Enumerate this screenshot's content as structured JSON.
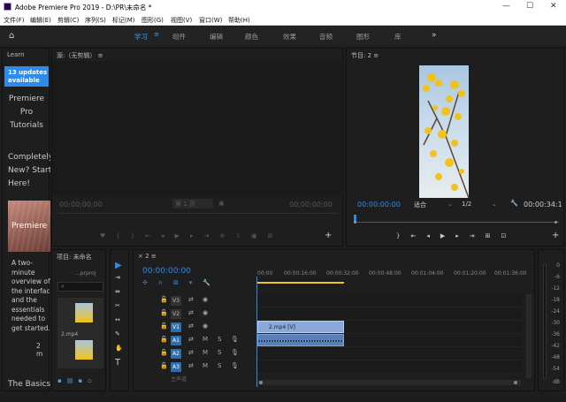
{
  "window": {
    "title": "Adobe Premiere Pro 2019 - D:\\PR\\未命名 *",
    "minimize": "—",
    "maximize": "☐",
    "close": "✕"
  },
  "menu": [
    "文件(F)",
    "编辑(E)",
    "剪辑(C)",
    "序列(S)",
    "标记(M)",
    "图形(G)",
    "视图(V)",
    "窗口(W)",
    "帮助(H)"
  ],
  "workspaces": {
    "items": [
      "学习",
      "组件",
      "编辑",
      "颜色",
      "效果",
      "音频",
      "图形",
      "库"
    ],
    "active": "学习",
    "more": "»"
  },
  "learn": {
    "tab": "Learn",
    "updates": "13 updates available",
    "tutorial": [
      "Premiere",
      "Pro",
      "Tutorials"
    ],
    "prompt": [
      "Completely",
      "New? Start",
      "Here!"
    ],
    "card_title": "Premiere",
    "desc": [
      "A two-",
      "minute",
      "overview of",
      "the interface",
      "and the",
      "essentials",
      "needed to",
      "get started."
    ],
    "duration": "2 m",
    "basics": "The Basics"
  },
  "source": {
    "title": "源:（无剪辑）",
    "tc_left": "00;00;00;00",
    "page": "第 1 页",
    "tc_right": "00;00;00;00"
  },
  "program": {
    "title": "节目: 2",
    "tc_left": "00:00:00:00",
    "fit": "适合",
    "ratio": "1/2",
    "tc_right": "00:00:34:1"
  },
  "project": {
    "title": "项目: 未命名",
    "file": "...prproj",
    "clip": "2.mp4"
  },
  "timeline": {
    "tab": "2",
    "timecode": "00:00:00:00",
    "ruler": [
      "00:00",
      "00:00:16:00",
      "00:00:32:00",
      "00:00:48:00",
      "00:01:04:00",
      "00:01:20:00",
      "00:01:36:00"
    ],
    "video_tracks": [
      "V3",
      "V2",
      "V1"
    ],
    "audio_tracks": [
      "A1",
      "A2",
      "A3"
    ],
    "clip_label": "2.mp4 [V]",
    "master": "主声道",
    "M": "M",
    "S": "S"
  },
  "meter": {
    "scale": [
      "0",
      "-6",
      "-12",
      "-18",
      "-24",
      "-30",
      "-36",
      "-42",
      "-48",
      "-54"
    ],
    "db": "dB"
  },
  "colors": {
    "accent": "#2d8ceb",
    "clip_video": "#8aa8d8",
    "clip_audio": "#5a7fb8"
  }
}
